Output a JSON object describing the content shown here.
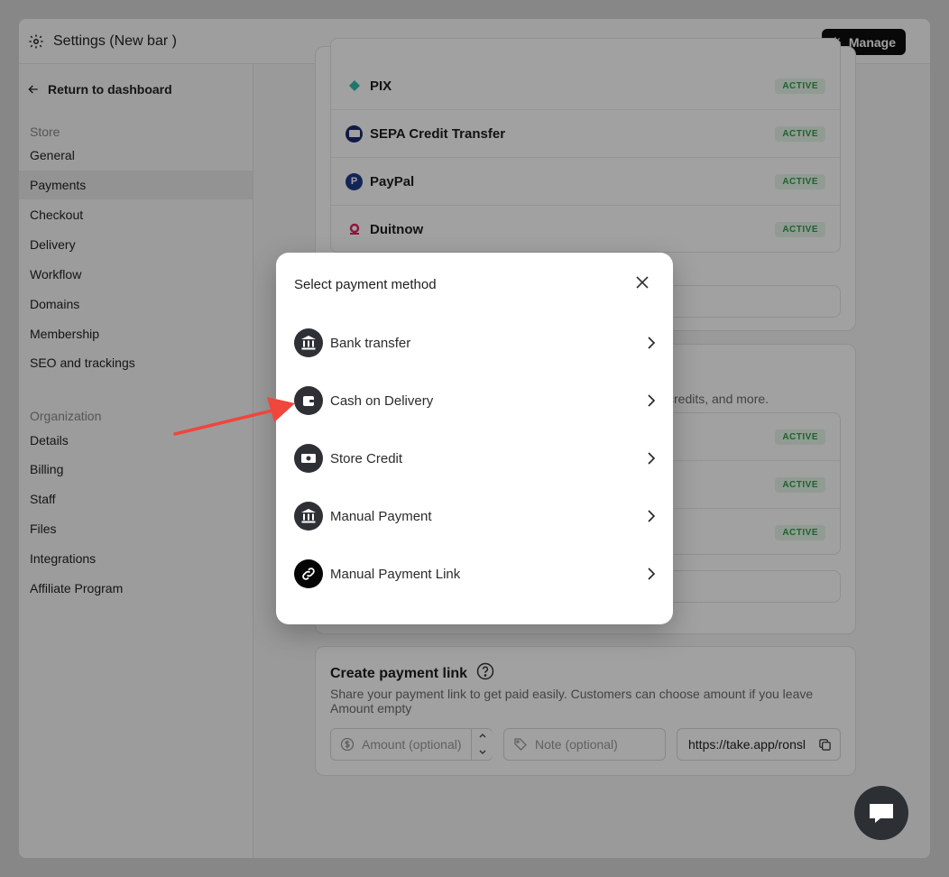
{
  "window": {
    "title": "Settings (New bar )",
    "manage_label": "Manage"
  },
  "sidebar": {
    "back_label": "Return to dashboard",
    "store_title": "Store",
    "store_items": [
      "General",
      "Payments",
      "Checkout",
      "Delivery",
      "Workflow",
      "Domains",
      "Membership",
      "SEO and trackings"
    ],
    "org_title": "Organization",
    "org_items": [
      "Details",
      "Billing",
      "Staff",
      "Files",
      "Integrations",
      "Affiliate Program"
    ]
  },
  "payments": {
    "rows": [
      {
        "name": "PIX",
        "status": "ACTIVE"
      },
      {
        "name": "SEPA Credit Transfer",
        "status": "ACTIVE"
      },
      {
        "name": "PayPal",
        "status": "ACTIVE"
      },
      {
        "name": "Duitnow",
        "status": "ACTIVE"
      }
    ],
    "other_desc_fragment": "credits, and more.",
    "other_rows": [
      {
        "status": "ACTIVE"
      },
      {
        "status": "ACTIVE"
      },
      {
        "status": "ACTIVE"
      }
    ]
  },
  "payment_link": {
    "title": "Create payment link",
    "description": "Share your payment link to get paid easily. Customers can choose amount if you leave Amount empty",
    "amount_placeholder": "Amount (optional)",
    "note_placeholder": "Note (optional)",
    "url_value": "https://take.app/ronsl"
  },
  "modal": {
    "title": "Select payment method",
    "methods": [
      {
        "label": "Bank transfer",
        "icon": "bank-icon"
      },
      {
        "label": "Cash on Delivery",
        "icon": "wallet-icon"
      },
      {
        "label": "Store Credit",
        "icon": "cash-icon"
      },
      {
        "label": "Manual Payment",
        "icon": "bank-icon"
      },
      {
        "label": "Manual Payment Link",
        "icon": "link-icon"
      }
    ]
  },
  "colors": {
    "accent_badge": "#2e9e47",
    "annotation_arrow": "#f0463c",
    "dark": "#0e0e0e"
  }
}
